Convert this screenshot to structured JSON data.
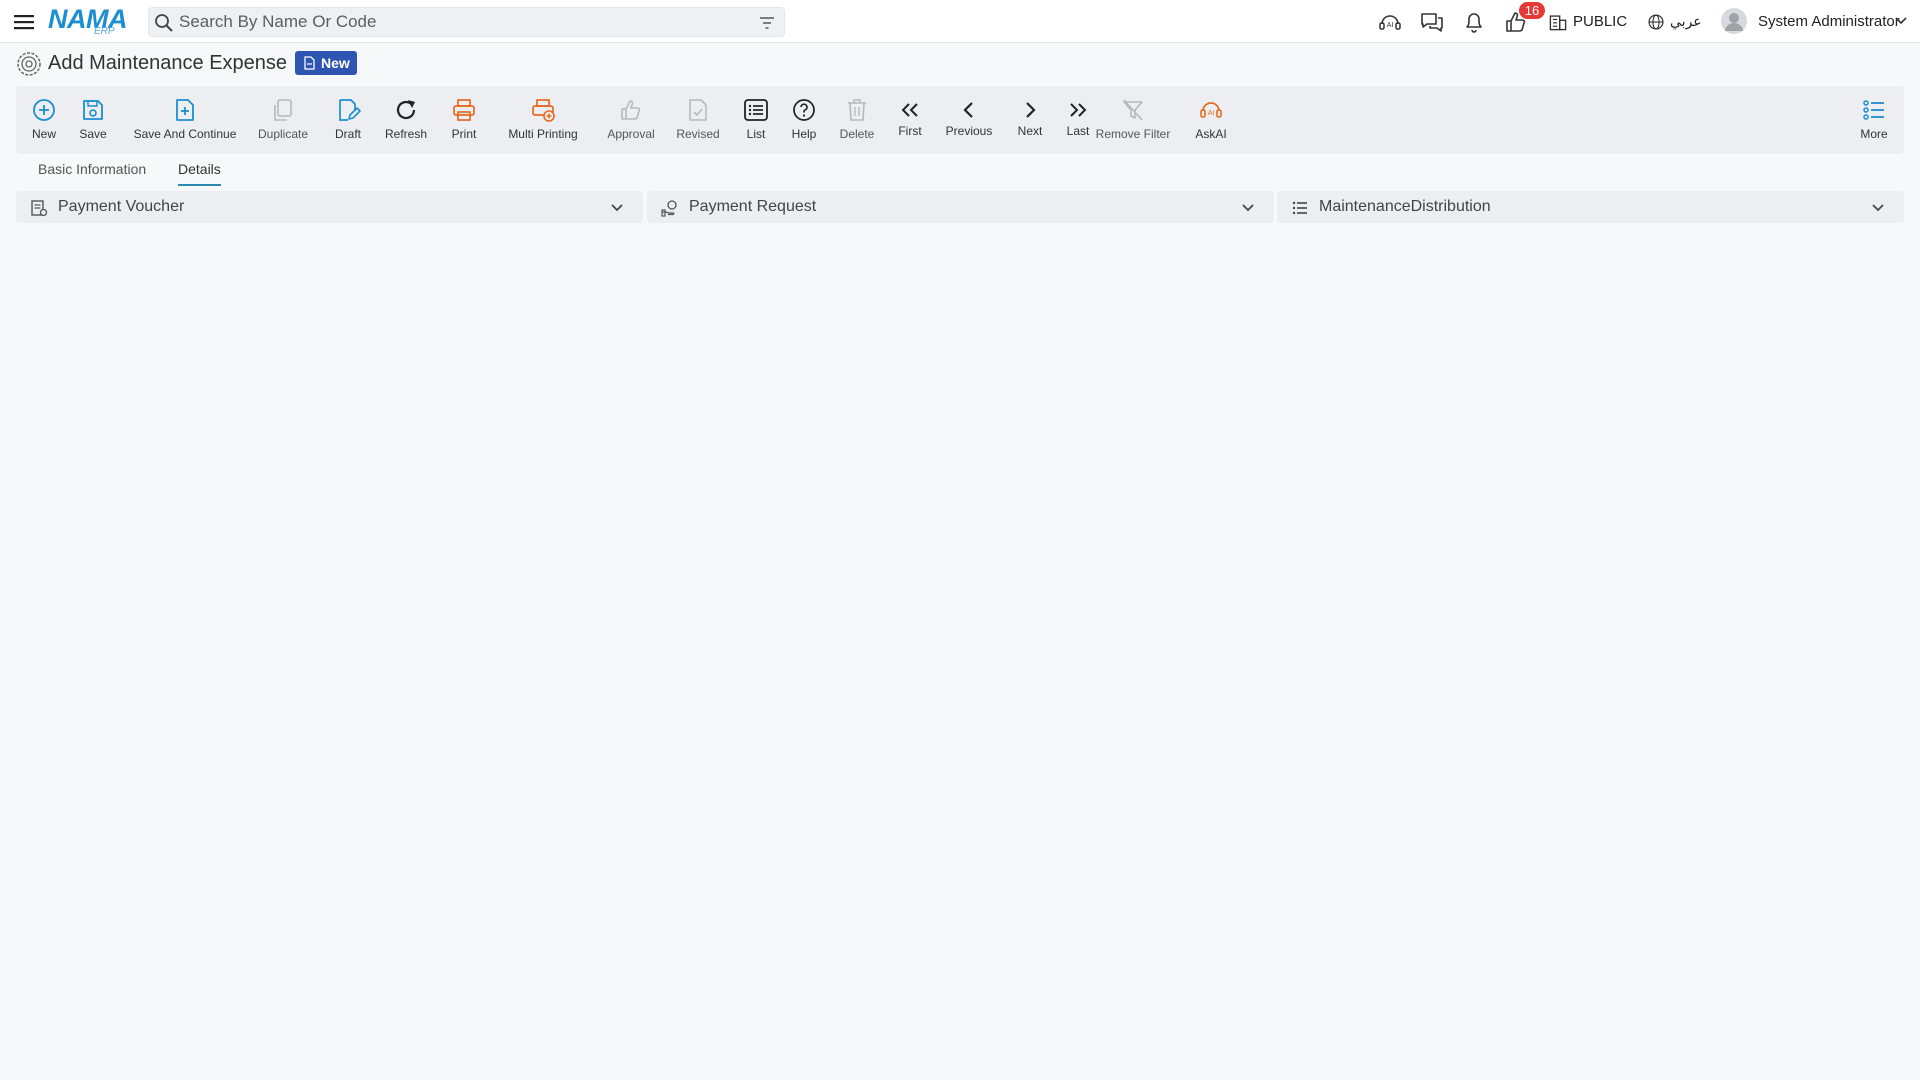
{
  "colors": {
    "accent": "#1d8fd1",
    "orange": "#e86a1f",
    "badge": "#e53935",
    "status_pill": "#2f55b3",
    "tab_underline": "#2a8ab0"
  },
  "header": {
    "logo_text": "NAMA",
    "logo_sub": "ERP",
    "search_placeholder": "Search By Name Or Code",
    "notification_count": "16",
    "branch": "PUBLIC",
    "language": "عربي",
    "user_name": "System Administrator"
  },
  "page": {
    "title": "Add Maintenance Expense",
    "status": "New"
  },
  "toolbar": {
    "buttons": [
      {
        "label": "New",
        "icon": "plus-circle-icon"
      },
      {
        "label": "Save",
        "icon": "save-icon"
      },
      {
        "label": "Save And Continue",
        "icon": "save-continue-icon"
      },
      {
        "label": "Duplicate",
        "icon": "duplicate-icon"
      },
      {
        "label": "Draft",
        "icon": "draft-icon"
      },
      {
        "label": "Refresh",
        "icon": "refresh-icon"
      },
      {
        "label": "Print",
        "icon": "print-icon"
      },
      {
        "label": "Multi Printing",
        "icon": "multi-print-icon"
      },
      {
        "label": "Approval",
        "icon": "thumbs-up-icon"
      },
      {
        "label": "Revised",
        "icon": "revised-icon"
      },
      {
        "label": "List",
        "icon": "list-icon"
      },
      {
        "label": "Help",
        "icon": "help-icon"
      },
      {
        "label": "Delete",
        "icon": "trash-icon"
      },
      {
        "label": "First",
        "icon": "double-chevron-left-icon"
      },
      {
        "label": "Previous",
        "icon": "chevron-left-icon"
      },
      {
        "label": "Next",
        "icon": "chevron-right-icon"
      },
      {
        "label": "Last",
        "icon": "double-chevron-right-icon"
      },
      {
        "label": "Remove Filter",
        "icon": "remove-filter-icon"
      },
      {
        "label": "AskAI",
        "icon": "ai-assistant-icon"
      },
      {
        "label": "More",
        "icon": "more-list-icon"
      }
    ]
  },
  "tabs": [
    {
      "label": "Basic Information",
      "active": false
    },
    {
      "label": "Details",
      "active": true
    }
  ],
  "panels": [
    {
      "label": "Payment Voucher",
      "icon": "voucher-icon"
    },
    {
      "label": "Payment Request",
      "icon": "payment-request-icon"
    },
    {
      "label": "MaintenanceDistribution",
      "icon": "list-icon"
    }
  ]
}
